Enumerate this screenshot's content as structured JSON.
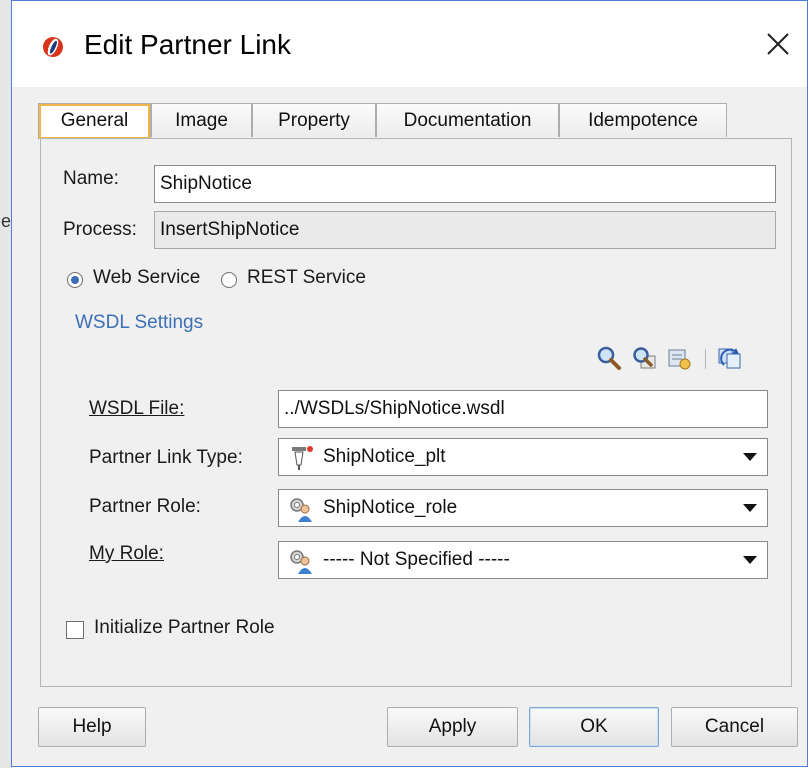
{
  "background_window": {
    "edge_text": "e"
  },
  "dialog": {
    "title": "Edit Partner Link",
    "accent_color": "#f2b54a",
    "link_color": "#3d6fb4",
    "logo_icon": "oracle-jdeveloper-logo-icon"
  },
  "tabs": [
    {
      "label": "General",
      "active": true
    },
    {
      "label": "Image",
      "active": false
    },
    {
      "label": "Property",
      "active": false
    },
    {
      "label": "Documentation",
      "active": false
    },
    {
      "label": "Idempotence",
      "active": false
    }
  ],
  "general": {
    "name_label": "Name:",
    "name_value": "ShipNotice",
    "process_label": "Process:",
    "process_value": "InsertShipNotice",
    "service_options": [
      {
        "label": "Web Service",
        "selected": true
      },
      {
        "label": "REST Service",
        "selected": false
      }
    ],
    "wsdl_settings_label": "WSDL Settings",
    "toolbar_icons": [
      "search-icon",
      "browse-service-icon",
      "service-explorer-icon",
      "refresh-icon"
    ],
    "wsdl_file_label": "WSDL File:",
    "wsdl_file_value": "../WSDLs/ShipNotice.wsdl",
    "partner_link_type_label": "Partner Link Type:",
    "partner_link_type_value": "ShipNotice_plt",
    "partner_role_label": "Partner Role:",
    "partner_role_value": "ShipNotice_role",
    "my_role_label": "My Role:",
    "my_role_value": "----- Not Specified -----",
    "initialize_label": "Initialize Partner Role",
    "initialize_checked": false
  },
  "buttons": {
    "help": "Help",
    "apply": "Apply",
    "ok": "OK",
    "cancel": "Cancel"
  }
}
